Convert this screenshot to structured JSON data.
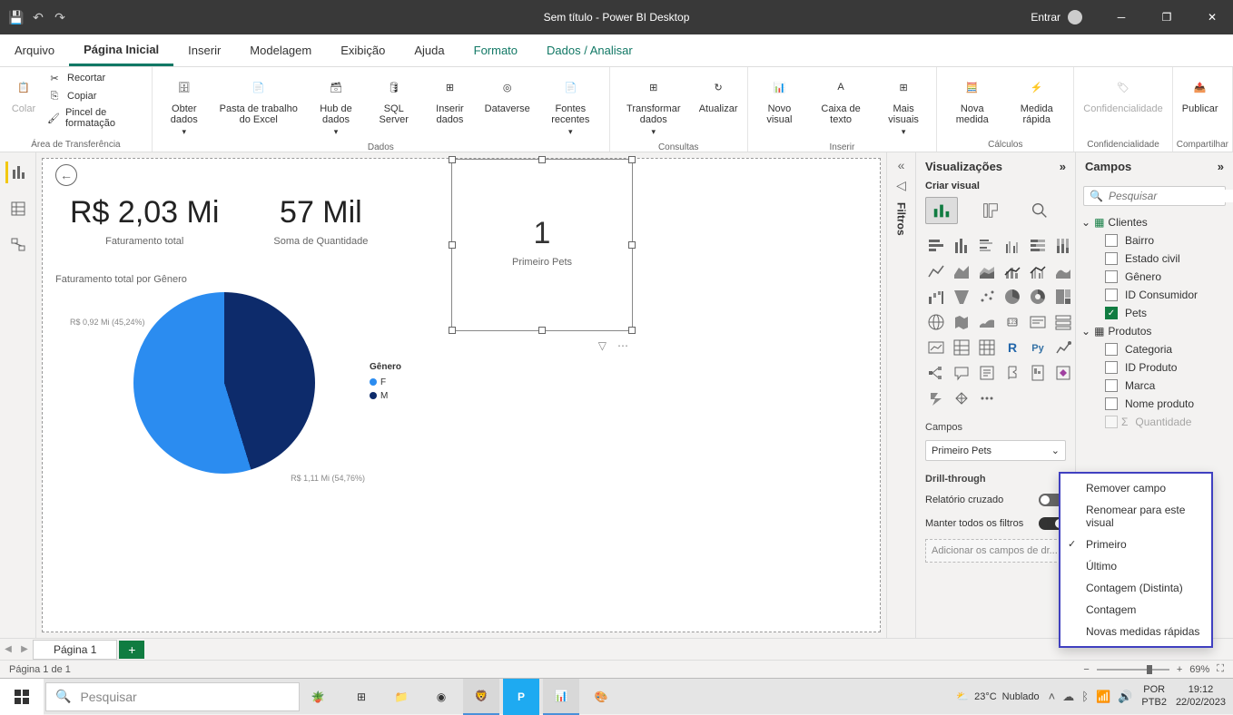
{
  "titlebar": {
    "title": "Sem título - Power BI Desktop",
    "login": "Entrar"
  },
  "menu": {
    "arquivo": "Arquivo",
    "pagina_inicial": "Página Inicial",
    "inserir": "Inserir",
    "modelagem": "Modelagem",
    "exibicao": "Exibição",
    "ajuda": "Ajuda",
    "formato": "Formato",
    "dados_analisar": "Dados / Analisar"
  },
  "ribbon": {
    "colar": "Colar",
    "recortar": "Recortar",
    "copiar": "Copiar",
    "pincel": "Pincel de formatação",
    "area_transferencia": "Área de Transferência",
    "obter_dados": "Obter dados",
    "pasta_excel": "Pasta de trabalho do Excel",
    "hub_dados": "Hub de dados",
    "sql_server": "SQL Server",
    "inserir_dados": "Inserir dados",
    "dataverse": "Dataverse",
    "fontes_recentes": "Fontes recentes",
    "dados": "Dados",
    "transformar_dados": "Transformar dados",
    "atualizar": "Atualizar",
    "consultas": "Consultas",
    "novo_visual": "Novo visual",
    "caixa_texto": "Caixa de texto",
    "mais_visuais": "Mais visuais",
    "inserir_grp": "Inserir",
    "nova_medida": "Nova medida",
    "medida_rapida": "Medida rápida",
    "calculos": "Cálculos",
    "confidencialidade": "Confidencialidade",
    "confidencialidade_grp": "Confidencialidade",
    "publicar": "Publicar",
    "compartilhar": "Compartilhar"
  },
  "canvas": {
    "kpi1_value": "R$ 2,03 Mi",
    "kpi1_label": "Faturamento total",
    "kpi2_value": "57 Mil",
    "kpi2_label": "Soma de Quantidade",
    "kpi3_value": "1",
    "kpi3_label": "Primeiro Pets",
    "chart_title": "Faturamento total por Gênero",
    "pie_label_top": "R$ 0,92 Mi (45,24%)",
    "pie_label_bottom": "R$ 1,11 Mi (54,76%)",
    "legend_title": "Gênero",
    "legend_f": "F",
    "legend_m": "M"
  },
  "chart_data": {
    "type": "pie",
    "title": "Faturamento total por Gênero",
    "legend_position": "right",
    "series": [
      {
        "name": "F",
        "value_label": "R$ 0,92 Mi",
        "percent": 45.24,
        "color": "#0d2b6b"
      },
      {
        "name": "M",
        "value_label": "R$ 1,11 Mi",
        "percent": 54.76,
        "color": "#2b8cf0"
      }
    ]
  },
  "filters_label": "Filtros",
  "viz_panel": {
    "title": "Visualizações",
    "criar_visual": "Criar visual",
    "campos_section": "Campos",
    "field_value": "Primeiro Pets",
    "drill_through": "Drill-through",
    "relatorio_cruzado": "Relatório cruzado",
    "manter_filtros": "Manter todos os filtros",
    "drop_hint": "Adicionar os campos de dr..."
  },
  "fields_panel": {
    "title": "Campos",
    "search_placeholder": "Pesquisar",
    "table_clientes": "Clientes",
    "f_bairro": "Bairro",
    "f_estado_civil": "Estado civil",
    "f_genero": "Gênero",
    "f_id_consumidor": "ID Consumidor",
    "f_pets": "Pets",
    "table_produtos": "Produtos",
    "f_categoria": "Categoria",
    "f_id_produto": "ID Produto",
    "f_marca": "Marca",
    "f_nome_produto": "Nome produto",
    "f_quantidade": "Quantidade"
  },
  "context_menu": {
    "remover": "Remover campo",
    "renomear": "Renomear para este visual",
    "primeiro": "Primeiro",
    "ultimo": "Último",
    "contagem_distinta": "Contagem (Distinta)",
    "contagem": "Contagem",
    "novas_medidas": "Novas medidas rápidas"
  },
  "page_tabs": {
    "pagina1": "Página 1"
  },
  "statusbar": {
    "page_info": "Página 1 de 1",
    "zoom": "69%"
  },
  "taskbar": {
    "search": "Pesquisar",
    "weather_temp": "23°C",
    "weather_desc": "Nublado",
    "lang": "POR",
    "kb": "PTB2",
    "time": "19:12",
    "date": "22/02/2023"
  }
}
